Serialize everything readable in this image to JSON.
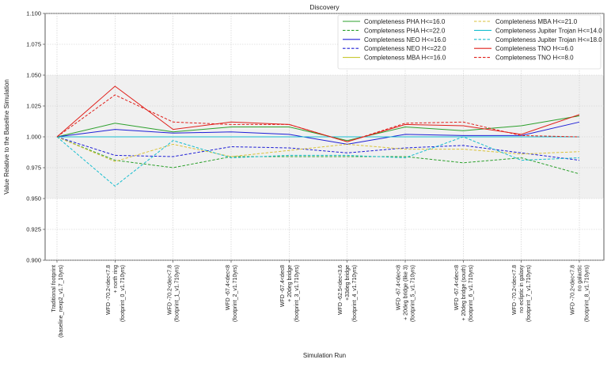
{
  "chart_data": {
    "type": "line",
    "title": "Discovery",
    "xlabel": "Simulation Run",
    "ylabel": "Value Relative to the Baseline Simulation",
    "ylim": [
      0.9,
      1.1
    ],
    "yticks": [
      "0.900",
      "0.925",
      "0.950",
      "0.975",
      "1.000",
      "1.025",
      "1.050",
      "1.075",
      "1.100"
    ],
    "shaded_band": [
      0.95,
      1.05
    ],
    "grid": true,
    "legend_position": "top-right",
    "categories": [
      [
        "Traditional footprint",
        "(baseline_nexp2_v1.7_10yrs)"
      ],
      [
        "WFD -70.2<dec<7.8",
        "+ north ring",
        "(footprint_0_v1.710yrs)"
      ],
      [
        "WFD -70.2<dec<7.8",
        "(footprint_1_v1.710yrs)"
      ],
      [
        "WFD -67.4<dec<8",
        "(footprint_2_v1.710yrs)"
      ],
      [
        "WFD -67.4<dec8",
        "+ 20deg bridge",
        "(footprint_3_v1.710yrs)"
      ],
      [
        "WFD -62.5<dec<3.6",
        "+33deg bridge",
        "(footprint_4_v1.710yrs)"
      ],
      [
        "WFD -67.4<dec<8",
        "+ 20deg bridge (like 3)",
        "(footprint_5_v1.710yrs)"
      ],
      [
        "WFD -67.4<dec<8",
        "+ 20deg bridge (south)",
        "(footprint_6_v1.710yrs)"
      ],
      [
        "WFD -70.2<dec<7.8",
        "no ecliptic in galaxy",
        "(footprint_7_v1.710yrs)"
      ],
      [
        "WFD -70.2<dec<7.8",
        "no galactic",
        "(footprint_8_v1.710yrs)"
      ]
    ],
    "series": [
      {
        "name": "Completeness PHA H<=16.0",
        "color": "#2ca02c",
        "dash": false,
        "values": [
          1.0,
          1.011,
          1.004,
          1.008,
          1.008,
          0.997,
          1.008,
          1.005,
          1.009,
          1.017
        ]
      },
      {
        "name": "Completeness PHA H<=22.0",
        "color": "#2ca02c",
        "dash": true,
        "values": [
          1.0,
          0.981,
          0.975,
          0.984,
          0.984,
          0.984,
          0.984,
          0.979,
          0.983,
          0.97
        ]
      },
      {
        "name": "Completeness NEO H<=16.0",
        "color": "#1f1fd6",
        "dash": false,
        "values": [
          1.0,
          1.006,
          1.003,
          1.004,
          1.002,
          0.994,
          1.002,
          1.001,
          1.001,
          1.012
        ]
      },
      {
        "name": "Completeness NEO H<=22.0",
        "color": "#1f1fd6",
        "dash": true,
        "values": [
          1.0,
          0.985,
          0.984,
          0.992,
          0.991,
          0.987,
          0.991,
          0.993,
          0.987,
          0.981
        ]
      },
      {
        "name": "Completeness MBA H<=16.0",
        "color": "#c8c832",
        "dash": false,
        "values": [
          1.0,
          1.0,
          1.0,
          1.0,
          1.0,
          1.0,
          1.0,
          1.0,
          1.0,
          1.0
        ]
      },
      {
        "name": "Completeness MBA H<=21.0",
        "color": "#d9c23a",
        "dash": true,
        "values": [
          1.0,
          0.98,
          0.994,
          0.984,
          0.989,
          0.994,
          0.99,
          0.99,
          0.986,
          0.988
        ]
      },
      {
        "name": "Completeness Jupiter Trojan H<=14.0",
        "color": "#17becf",
        "dash": false,
        "values": [
          1.0,
          1.0,
          1.0,
          1.0,
          1.0,
          1.0,
          1.0,
          1.0,
          1.0,
          1.0
        ]
      },
      {
        "name": "Completeness Jupiter Trojan H<=18.0",
        "color": "#17becf",
        "dash": true,
        "values": [
          1.0,
          0.96,
          0.997,
          0.983,
          0.985,
          0.985,
          0.983,
          1.0,
          0.981,
          0.983
        ]
      },
      {
        "name": "Completeness TNO H<=6.0",
        "color": "#e0201b",
        "dash": false,
        "values": [
          1.0,
          1.041,
          1.006,
          1.012,
          1.01,
          0.996,
          1.01,
          1.009,
          1.002,
          1.018
        ]
      },
      {
        "name": "Completeness TNO H<=8.0",
        "color": "#e0201b",
        "dash": true,
        "values": [
          1.0,
          1.034,
          1.012,
          1.01,
          1.01,
          0.996,
          1.011,
          1.012,
          1.001,
          1.0
        ]
      }
    ]
  }
}
